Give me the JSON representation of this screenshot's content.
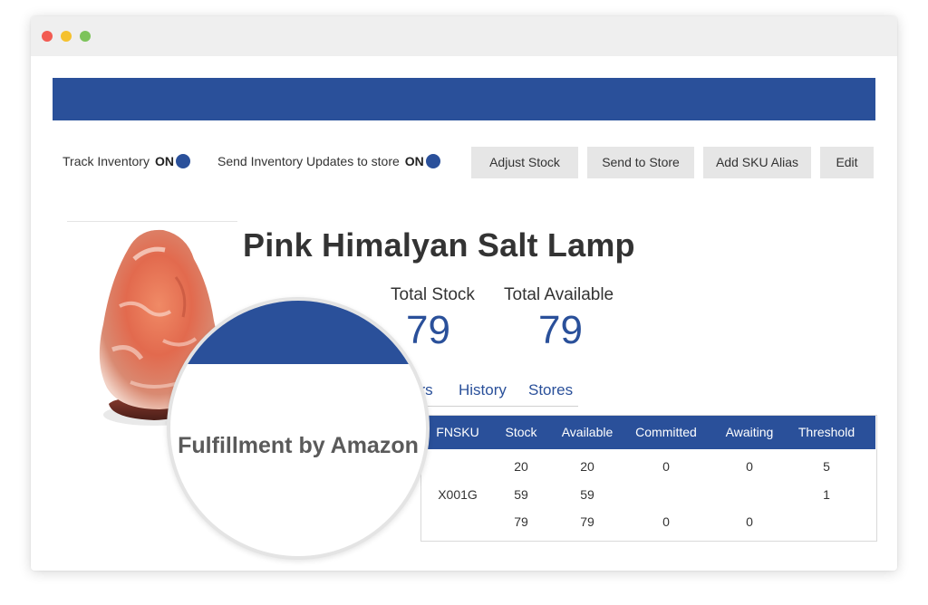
{
  "colors": {
    "brand_blue": "#2a509a",
    "text_dark": "#333333",
    "button_bg": "#e6e6e6",
    "dot_red": "#f25b52",
    "dot_yellow": "#f5c12e",
    "dot_green": "#7cc35a"
  },
  "toolbar": {
    "track_inventory_label": "Track Inventory",
    "track_inventory_state": "ON",
    "send_updates_label": "Send Inventory Updates to store",
    "send_updates_state": "ON",
    "buttons": {
      "adjust_stock": "Adjust Stock",
      "send_to_store": "Send to Store",
      "add_sku_alias": "Add SKU Alias",
      "edit": "Edit"
    }
  },
  "product": {
    "title": "Pink Himalyan Salt Lamp",
    "image_icon": "salt-lamp-image",
    "total_stock_label": "Total Stock",
    "total_stock_value": "79",
    "total_available_label": "Total Available",
    "total_available_value": "79"
  },
  "tabs": {
    "partial": "ers",
    "history": "History",
    "stores": "Stores"
  },
  "table": {
    "headers": [
      "FNSKU",
      "Stock",
      "Available",
      "Committed",
      "Awaiting",
      "Threshold"
    ],
    "rows": [
      [
        "",
        "20",
        "20",
        "0",
        "0",
        "5"
      ],
      [
        "X001G",
        "59",
        "59",
        "",
        "",
        "1"
      ],
      [
        "",
        "79",
        "79",
        "0",
        "0",
        ""
      ]
    ]
  },
  "magnifier": {
    "label": "Fulfillment by Amazon"
  }
}
